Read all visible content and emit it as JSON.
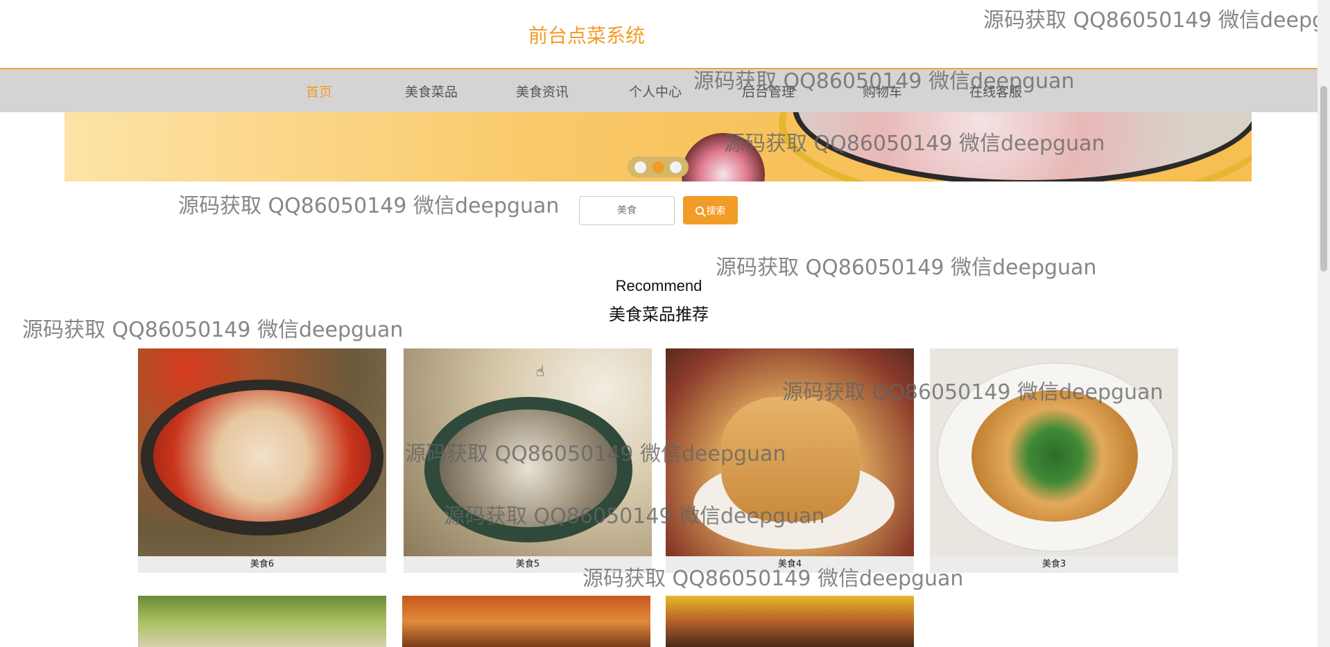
{
  "header": {
    "title": "前台点菜系统"
  },
  "nav": {
    "items": [
      {
        "label": "首页",
        "active": true
      },
      {
        "label": "美食菜品"
      },
      {
        "label": "美食资讯"
      },
      {
        "label": "个人中心"
      },
      {
        "label": "后台管理"
      },
      {
        "label": "购物车"
      },
      {
        "label": "在线客服"
      }
    ]
  },
  "banner": {
    "slide_count": 3,
    "active_slide": 2
  },
  "search": {
    "placeholder": "美食",
    "button_label": "搜索"
  },
  "recommend": {
    "title_en": "Recommend",
    "title_cn": "美食菜品推荐",
    "items": [
      {
        "label": "美食6"
      },
      {
        "label": "美食5"
      },
      {
        "label": "美食4"
      },
      {
        "label": "美食3"
      }
    ]
  },
  "watermark": {
    "text": "源码获取 QQ86050149 微信deepguan",
    "text_truncated": "源码获取 QQ86050149 微信deepgu"
  },
  "colors": {
    "accent": "#f29b26",
    "nav_bg": "#d4d4d4"
  },
  "icons": [
    "search-icon",
    "pointer-cursor-icon"
  ]
}
